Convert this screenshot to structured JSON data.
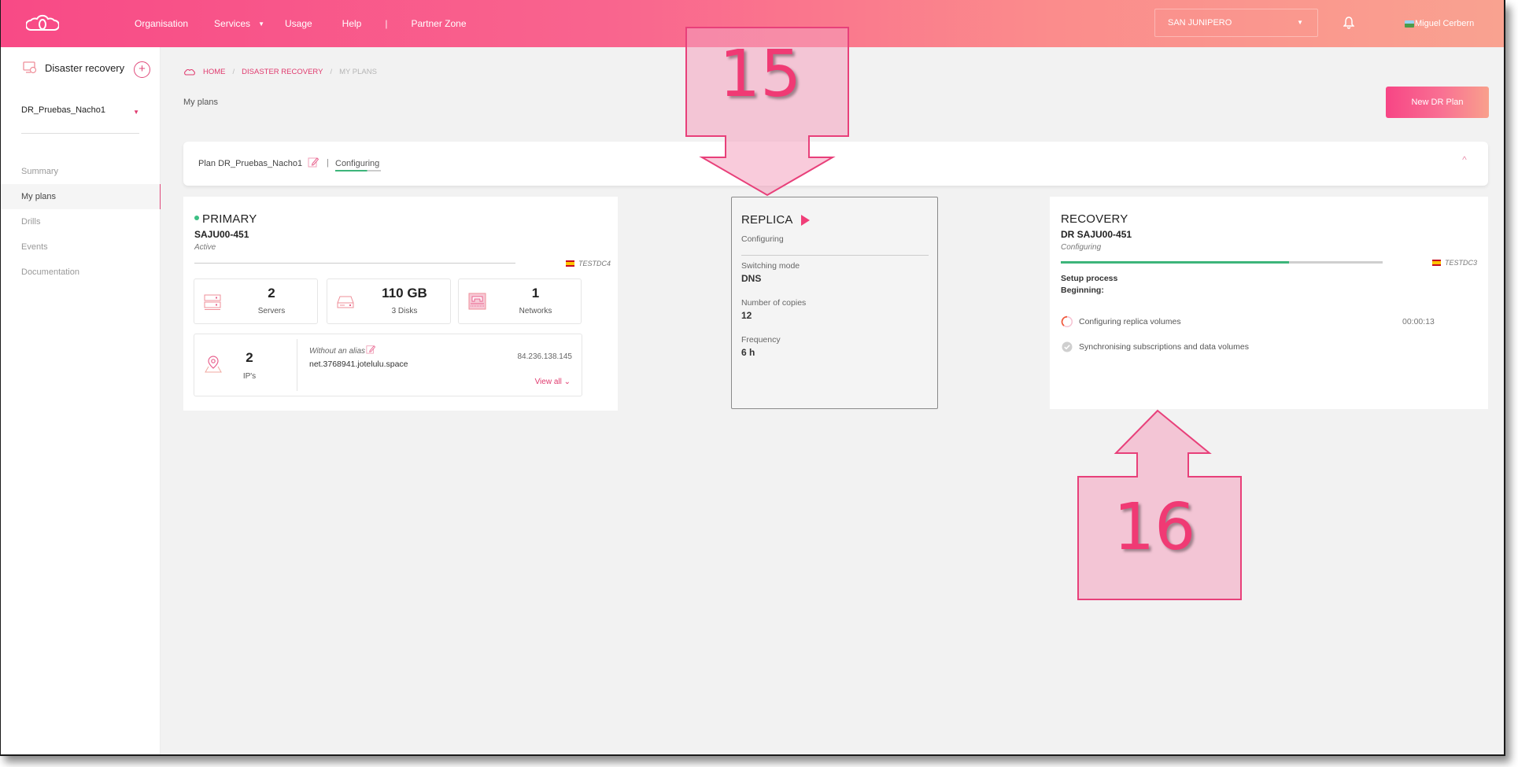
{
  "topbar": {
    "nav": [
      "Organisation",
      "Services",
      "Usage",
      "Help",
      "Partner Zone"
    ],
    "nav_separator": "|",
    "services_caret": "▼",
    "datacenter_select": "SAN JUNIPERO",
    "select_caret": "▼",
    "user_name": "Miguel Cerbern",
    "brand_colors": [
      "#f84a86",
      "#f9a290"
    ]
  },
  "sidebar": {
    "title": "Disaster recovery",
    "add_symbol": "+",
    "plan_selector": "DR_Pruebas_Nacho1",
    "plan_caret": "▼",
    "items": [
      {
        "label": "Summary",
        "active": false
      },
      {
        "label": "My plans",
        "active": true
      },
      {
        "label": "Drills",
        "active": false
      },
      {
        "label": "Events",
        "active": false
      },
      {
        "label": "Documentation",
        "active": false
      }
    ]
  },
  "breadcrumb": {
    "items": [
      "HOME",
      "DISASTER RECOVERY",
      "MY PLANS"
    ],
    "separator": "/"
  },
  "page": {
    "title": "My plans",
    "new_plan_button": "New DR Plan"
  },
  "plan": {
    "name": "Plan DR_Pruebas_Nacho1",
    "divider": "|",
    "status": "Configuring",
    "collapse_symbol": "^"
  },
  "primary": {
    "title": "PRIMARY",
    "server": "SAJU00-451",
    "status": "Active",
    "location": "TESTDC4",
    "stats": [
      {
        "value": "2",
        "label": "Servers",
        "icon": "servers-icon"
      },
      {
        "value": "110 GB",
        "label": "3 Disks",
        "icon": "disk-icon"
      },
      {
        "value": "1",
        "label": "Networks",
        "icon": "network-icon"
      }
    ],
    "ips": {
      "count": "2",
      "label": "IP's",
      "alias": "Without an alias",
      "hostname": "net.3768941.jotelulu.space",
      "address": "84.236.138.145",
      "view_all": "View all ⌄"
    }
  },
  "replica": {
    "title": "REPLICA",
    "status": "Configuring",
    "fields": [
      {
        "label": "Switching mode",
        "value": "DNS"
      },
      {
        "label": "Number of copies",
        "value": "12"
      },
      {
        "label": "Frequency",
        "value": "6 h"
      }
    ]
  },
  "recovery": {
    "title": "RECOVERY",
    "server": "DR SAJU00-451",
    "status": "Configuring",
    "location": "TESTDC3",
    "progress_percent": 71,
    "setup_label": "Setup process",
    "beginning_label": "Beginning:",
    "steps": [
      {
        "label": "Configuring replica volumes",
        "state": "in-progress",
        "time": "00:00:13"
      },
      {
        "label": "Synchronising subscriptions and data volumes",
        "state": "pending",
        "time": ""
      }
    ],
    "progress_color": "#3db57a"
  },
  "annotations": [
    {
      "number": "15",
      "points_to": "replica",
      "direction": "down"
    },
    {
      "number": "16",
      "points_to": "recovery",
      "direction": "up"
    }
  ]
}
